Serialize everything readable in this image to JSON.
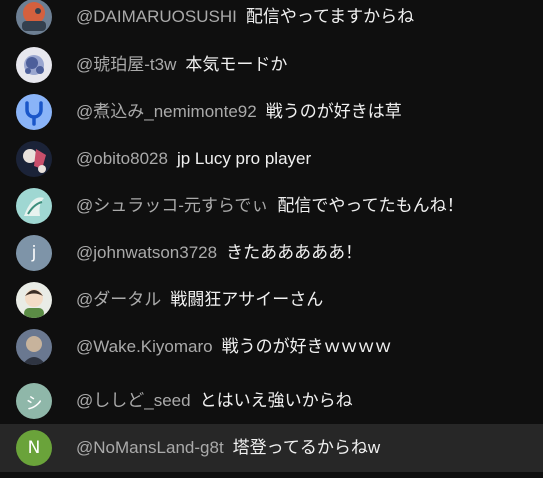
{
  "chat": {
    "messages": [
      {
        "author": "@DAIMARUOSUSHI",
        "text": "配信やってますからね",
        "avatar": {
          "type": "image",
          "colors": [
            "#6d7f93",
            "#d4603e",
            "#34404e"
          ]
        }
      },
      {
        "author": "@琥珀屋-t3w",
        "text": "本気モードか",
        "avatar": {
          "type": "image",
          "colors": [
            "#e7e7ee",
            "#4d5f9a",
            "#9aa6cf"
          ]
        }
      },
      {
        "author": "@煮込み_nemimonte92",
        "text": "戦うのが好きは草",
        "avatar": {
          "type": "icon",
          "icon": "tuning-fork-icon",
          "colors": [
            "#8ab4f8",
            "#1a56c9"
          ]
        }
      },
      {
        "author": "@obito8028",
        "text": "jp Lucy pro player",
        "avatar": {
          "type": "image",
          "colors": [
            "#1b2338",
            "#c94f6b",
            "#e9e2dc"
          ]
        }
      },
      {
        "author": "@シュラッコ-元すらでぃ",
        "text": "配信でやってたもんね！",
        "avatar": {
          "type": "image",
          "colors": [
            "#9fd7d2",
            "#3e8f7d",
            "#e7f3ef"
          ]
        }
      },
      {
        "author": "@johnwatson3728",
        "text": "きたあああああ！",
        "avatar": {
          "type": "letter",
          "letter": "j",
          "colors": [
            "#7e94a8"
          ]
        }
      },
      {
        "author": "@ダータル",
        "text": "戦闘狂アサイーさん",
        "avatar": {
          "type": "image",
          "colors": [
            "#e9ece6",
            "#5b8c45",
            "#3a2d25"
          ]
        }
      },
      {
        "author": "@Wake.Kiyomaro",
        "text": "戦うのが好きｗｗｗｗ",
        "avatar": {
          "type": "image",
          "colors": [
            "#6a7890",
            "#c7b39c",
            "#2f3542"
          ]
        }
      },
      {
        "author": "@ししど_seed",
        "text": "とはいえ強いからね",
        "avatar": {
          "type": "letter",
          "letter": "シ",
          "colors": [
            "#8fb7a9"
          ]
        }
      },
      {
        "author": "@NoMansLand-g8t",
        "text": "塔登ってるからねw",
        "avatar": {
          "type": "letter",
          "letter": "N",
          "colors": [
            "#6aa33a"
          ]
        },
        "highlighted": true
      }
    ]
  }
}
